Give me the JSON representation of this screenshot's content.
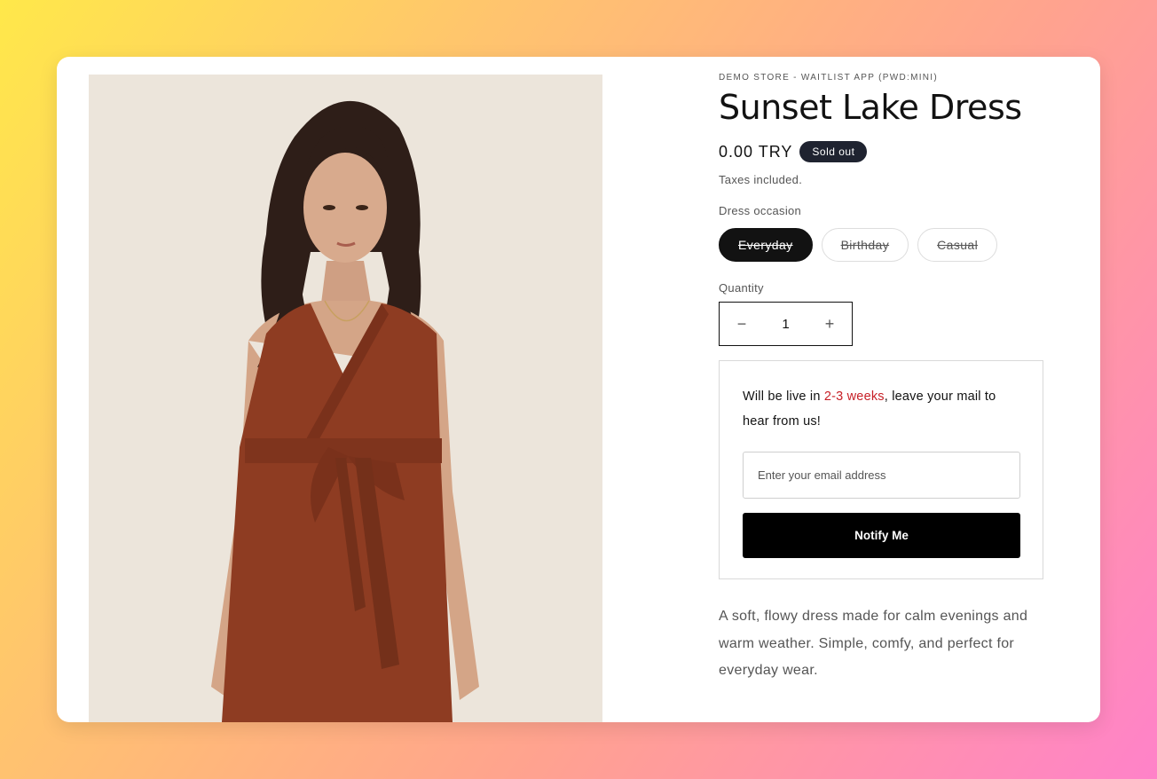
{
  "store_name": "DEMO STORE - WAITLIST APP (PWD:MINI)",
  "product": {
    "title": "Sunset Lake Dress",
    "price": "0.00 TRY",
    "badge": "Sold out",
    "tax_note": "Taxes included.",
    "image_alt": "Woman wearing a rust-colored sleeveless wrap dress with a tie belt"
  },
  "variant": {
    "label": "Dress occasion",
    "options": [
      "Everyday",
      "Birthday",
      "Casual"
    ],
    "selected": "Everyday"
  },
  "quantity": {
    "label": "Quantity",
    "value": "1",
    "minus": "−",
    "plus": "+"
  },
  "waitlist": {
    "text_before": "Will be live in ",
    "highlight": "2-3 weeks",
    "text_after": ", leave your mail to hear from us!",
    "highlight_color": "#c72027",
    "email_placeholder": "Enter your email address",
    "button_label": "Notify Me"
  },
  "description": "A soft, flowy dress made for calm evenings and warm weather. Simple, comfy, and perfect for everyday wear.",
  "colors": {
    "dress": "#8e3c22",
    "badge_bg": "#1f2330",
    "button_bg": "#000000"
  }
}
